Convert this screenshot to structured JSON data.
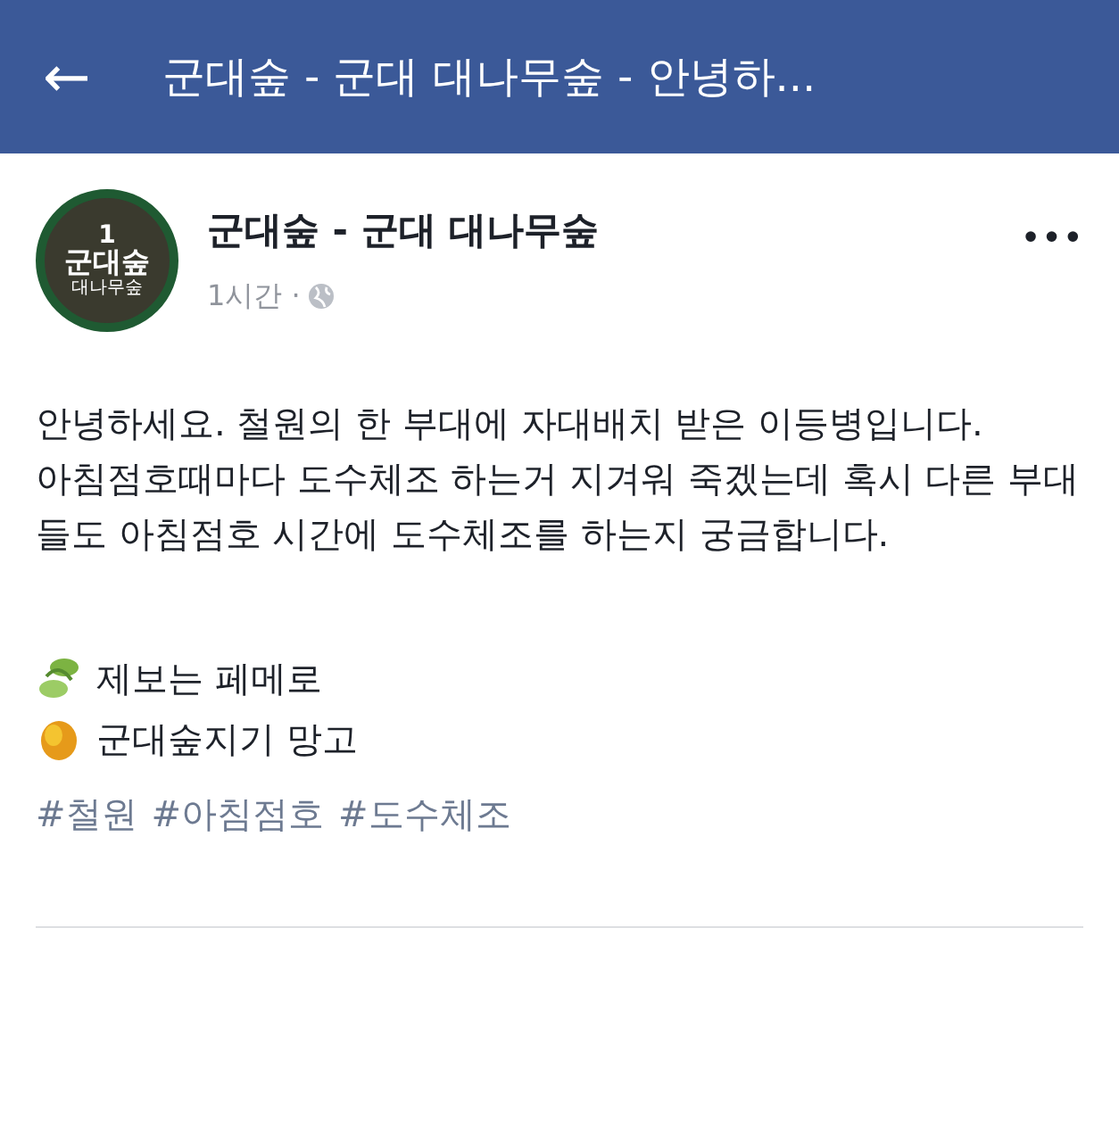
{
  "app_bar": {
    "back_icon": "←",
    "title": "군대숲 - 군대 대나무숲 - 안녕하..."
  },
  "post": {
    "avatar": {
      "number": "1",
      "name": "군대숲",
      "subtitle": "대나무숲"
    },
    "author": "군대숲 - 군대 대나무숲",
    "time": "1시간 ·",
    "more": "•••",
    "paragraphs": [
      "안녕하세요. 철원의 한 부대에 자대배치 받은 이등병입니다.",
      "아침점호때마다 도수체조 하는거 지겨워 죽겠는데 혹시 다른 부대들도 아침점호 시간에 도수체조를 하는지 궁금합니다."
    ],
    "footer_lines": [
      {
        "kind": "leaf",
        "text": "제보는 페메로"
      },
      {
        "kind": "mango",
        "text": "군대숲지기 망고"
      }
    ],
    "hashtags": [
      "#철원",
      "#아침점호",
      "#도수체조"
    ]
  }
}
